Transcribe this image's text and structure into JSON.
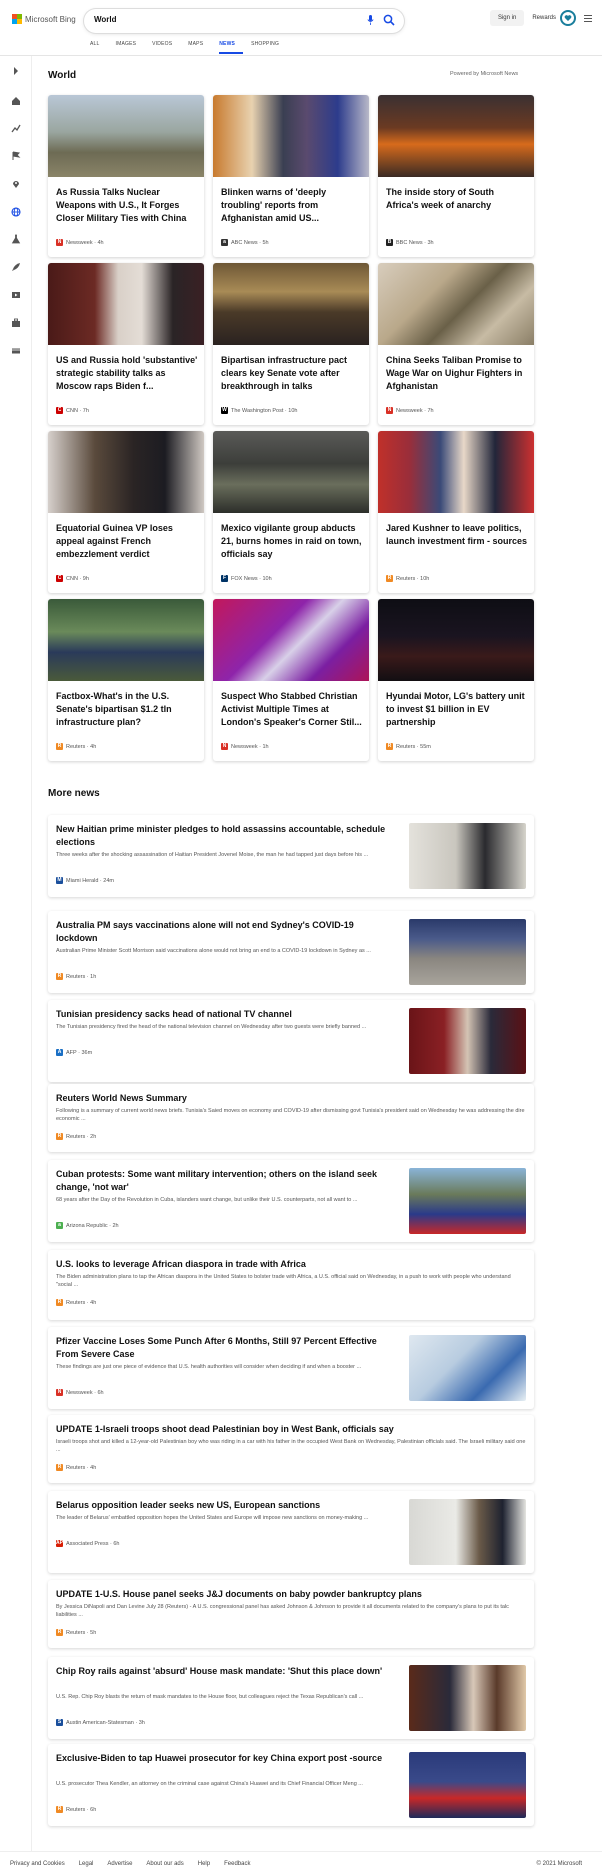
{
  "header": {
    "brand": "Microsoft Bing",
    "query": "World",
    "signin": "Sign in",
    "rewards": "Rewards"
  },
  "tabs": [
    "ALL",
    "IMAGES",
    "VIDEOS",
    "MAPS",
    "NEWS",
    "SHOPPING"
  ],
  "active_tab": "NEWS",
  "section": {
    "title": "World",
    "powered": "Powered by Microsoft News"
  },
  "cards": [
    {
      "title": "As Russia Talks Nuclear Weapons with U.S., It Forges Closer Military Ties with China",
      "source": "Newsweek · 4h",
      "icon": "N",
      "color": "#d93025",
      "img": "linear-gradient(180deg,#b9c7d6 0%,#9aa6a0 45%,#6d6b54 70%,#8a8468 100%)"
    },
    {
      "title": "Blinken warns of 'deeply troubling' reports from Afghanistan amid US...",
      "source": "ABC News · 5h",
      "icon": "a",
      "color": "#333",
      "img": "linear-gradient(90deg,#c87a2e 0%,#e8d2b0 25%,#3a3f52 45%,#5a4a6e 60%,#2d3c8c 80%,#b8b8c8 100%)"
    },
    {
      "title": "The inside story of South Africa's week of anarchy",
      "source": "BBC News · 3h",
      "icon": "B",
      "color": "#222",
      "img": "linear-gradient(180deg,#3a3032 0%,#6b3a22 40%,#d76b1c 60%,#3a2a24 100%)"
    },
    {
      "title": "US and Russia hold 'substantive' strategic stability talks as Moscow raps Biden f...",
      "source": "CNN · 7h",
      "icon": "C",
      "color": "#cc0000",
      "img": "linear-gradient(90deg,#4a1a18 0%,#6c2a24 30%,#d9d0c8 45%,#e4ddd6 60%,#2a2426 80%,#3a2024 100%)"
    },
    {
      "title": "Bipartisan infrastructure pact clears key Senate vote after breakthrough in talks",
      "source": "The Washington Post · 10h",
      "icon": "W",
      "color": "#000",
      "img": "linear-gradient(180deg,#6e5836 0%,#a98b56 35%,#4a3a28 60%,#2a2220 100%)"
    },
    {
      "title": "China Seeks Taliban Promise to Wage War on Uighur Fighters in Afghanistan",
      "source": "Newsweek · 7h",
      "icon": "N",
      "color": "#d93025",
      "img": "linear-gradient(135deg,#d8cdbd 0%,#b9a88a 35%,#6a6048 55%,#c7bba4 75%,#8a7e66 100%)"
    },
    {
      "title": "Equatorial Guinea VP loses appeal against French embezzlement verdict",
      "source": "CNN · 9h",
      "icon": "C",
      "color": "#cc0000",
      "img": "linear-gradient(90deg,#d6d0cc 0%,#5a4a3c 30%,#2a2424 55%,#1c1c22 75%,#cfc8c2 100%)"
    },
    {
      "title": "Mexico vigilante group abducts 21, burns homes in raid on town, officials say",
      "source": "FOX News · 10h",
      "icon": "F",
      "color": "#003366",
      "img": "linear-gradient(180deg,#5a5a58 0%,#3c3e3a 40%,#6a6e5c 65%,#2c2e2a 100%)"
    },
    {
      "title": "Jared Kushner to leave politics, launch investment firm - sources",
      "source": "Reuters · 10h",
      "icon": "R",
      "color": "#f08a24",
      "img": "linear-gradient(90deg,#c0302a 0%,#9a2e3a 20%,#3a4a78 40%,#e8d8c8 55%,#22263a 75%,#cc3030 100%)"
    },
    {
      "title": "Factbox-What's in the U.S. Senate's bipartisan $1.2 tln infrastructure plan?",
      "source": "Reuters · 4h",
      "icon": "R",
      "color": "#f08a24",
      "img": "linear-gradient(180deg,#3a5a3a 0%,#6a8a5a 40%,#2a3a5a 65%,#4a5a3a 100%)"
    },
    {
      "title": "Suspect Who Stabbed Christian Activist Multiple Times at London's Speaker's Corner Stil...",
      "source": "Newsweek · 1h",
      "icon": "N",
      "color": "#d93025",
      "img": "linear-gradient(135deg,#c2185b 0%,#8e24aa 40%,#d8d0e8 55%,#7b1fa2 75%,#ad1457 100%)"
    },
    {
      "title": "Hyundai Motor, LG's battery unit to invest $1 billion in EV partnership",
      "source": "Reuters · 55m",
      "icon": "R",
      "color": "#f08a24",
      "img": "linear-gradient(180deg,#0e0e14 0%,#1a1420 45%,#3a1a1a 70%,#120e12 100%)"
    }
  ],
  "more": {
    "title": "More news"
  },
  "rows": [
    {
      "title": "New Haitian prime minister pledges to hold assassins accountable, schedule elections",
      "snippet": "Three weeks after the shocking assassination of Haitian President Jovenel Moise, the man he had tapped just days before his ...",
      "source": "Miami Herald · 24m",
      "icon": "M",
      "color": "#1a4f9c",
      "img": "linear-gradient(90deg,#e4e2dc 0%,#c9c6be 40%,#2a2a2e 65%,#d6d4cc 100%)"
    },
    {
      "title": "Australia PM says vaccinations alone will not end Sydney's COVID-19 lockdown",
      "snippet": "Australian Prime Minister Scott Morrison said vaccinations alone would not bring an end to a COVID-19 lockdown in Sydney as ...",
      "source": "Reuters · 1h",
      "icon": "R",
      "color": "#f08a24",
      "img": "linear-gradient(180deg,#2a3a6a 0%,#4a5a8a 30%,#8a8680 60%,#a8a49c 100%)"
    },
    {
      "title": "Tunisian presidency sacks head of national TV channel",
      "snippet": "The Tunisian presidency fired the head of the national television channel on Wednesday after two guests were briefly banned ...",
      "source": "AFP · 36m",
      "icon": "A",
      "color": "#1a6fc4",
      "img": "linear-gradient(90deg,#6a1418 0%,#8a2024 30%,#d4c4b4 50%,#2a2a3a 70%,#5a1014 100%)"
    },
    {
      "title": "Reuters World News Summary",
      "snippet": "Following is a summary of current world news briefs. Tunisia's Saied moves on economy and COVID-19 after dismissing govt Tunisia's president said on Wednesday he was addressing the dire economic ...",
      "source": "Reuters · 2h",
      "icon": "R",
      "color": "#f08a24",
      "img": ""
    },
    {
      "title": "Cuban protests: Some want military intervention; others on the island seek change, 'not war'",
      "snippet": "68 years after the Day of the Revolution in Cuba, islanders want change, but unlike their U.S. counterparts, not all want to ...",
      "source": "Arizona Republic · 2h",
      "icon": "a",
      "color": "#4caf50",
      "img": "linear-gradient(180deg,#8ab4d8 0%,#6a7a5a 40%,#2a3a8a 70%,#c82828 100%)"
    },
    {
      "title": "U.S. looks to leverage African diaspora in trade with Africa",
      "snippet": "The Biden administration plans to tap the African diaspora in the United States to bolster trade with Africa, a U.S. official said on Wednesday, in a push to work with people who understand \"social ...",
      "source": "Reuters · 4h",
      "icon": "R",
      "color": "#f08a24",
      "img": ""
    },
    {
      "title": "Pfizer Vaccine Loses Some Punch After 6 Months, Still 97 Percent Effective From Severe Case",
      "snippet": "These findings are just one piece of evidence that U.S. health authorities will consider when deciding if and when a booster ...",
      "source": "Newsweek · 6h",
      "icon": "N",
      "color": "#d93025",
      "img": "linear-gradient(135deg,#dfe8f0 0%,#b8cce0 40%,#3a6ab0 70%,#e8f0f4 100%)"
    },
    {
      "title": "UPDATE 1-Israeli troops shoot dead Palestinian boy in West Bank, officials say",
      "snippet": "Israeli troops shot and killed a 12-year-old Palestinian boy who was riding in a car with his father in the occupied West Bank on Wednesday, Palestinian officials said. The Israeli military said one ...",
      "source": "Reuters · 4h",
      "icon": "R",
      "color": "#f08a24",
      "img": ""
    },
    {
      "title": "Belarus opposition leader seeks new US, European sanctions",
      "snippet": "The leader of Belarus' embattled opposition hopes the United States and Europe will impose new sanctions on money-making ...",
      "source": "Associated Press · 6h",
      "icon": "AP",
      "color": "#d81e05",
      "img": "linear-gradient(90deg,#d8d8d4 0%,#eaeae6 40%,#6a5a48 60%,#1e2230 80%,#e4e4e0 100%)"
    },
    {
      "title": "UPDATE 1-U.S. House panel seeks J&J documents on baby powder bankruptcy plans",
      "snippet": "By Jessica DiNapoli and Dan Levine July 28 (Reuters) - A U.S. congressional panel has asked Johnson & Johnson to provide it all documents related to the company's plans to put its talc liabilities ...",
      "source": "Reuters · 5h",
      "icon": "R",
      "color": "#f08a24",
      "img": ""
    },
    {
      "title": "Chip Roy rails against 'absurd' House mask mandate: 'Shut this place down'",
      "snippet": "U.S. Rep. Chip Roy blasts the return of mask mandates to the House floor, but colleagues reject the Texas Republican's call ...",
      "source": "Austin American-Statesman · 3h",
      "icon": "S",
      "color": "#1a4f9c",
      "img": "linear-gradient(90deg,#5a2a1a 0%,#2a2a3a 35%,#d8c8b8 55%,#5a3a2a 75%,#e0c8a8 100%)"
    },
    {
      "title": "Exclusive-Biden to tap Huawei prosecutor for key China export post -source",
      "snippet": "U.S. prosecutor Thea Kendler, an attorney on the criminal case against China's Huawei and its Chief Financial Officer Meng ...",
      "source": "Reuters · 6h",
      "icon": "R",
      "color": "#f08a24",
      "img": "linear-gradient(180deg,#2a3a7a 0%,#3a4a8a 45%,#c82828 70%,#1e2a5a 100%)"
    }
  ],
  "footer": {
    "links": [
      "Privacy and Cookies",
      "Legal",
      "Advertise",
      "About our ads",
      "Help",
      "Feedback"
    ],
    "copyright": "© 2021 Microsoft"
  }
}
